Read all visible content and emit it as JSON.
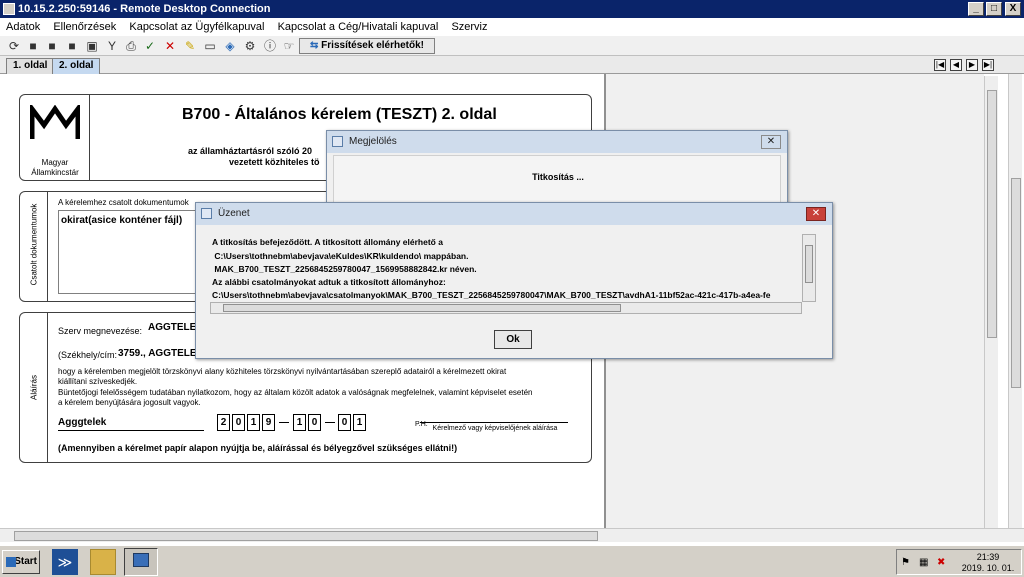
{
  "window": {
    "title": "10.15.2.250:59146 - Remote Desktop Connection",
    "min_label": "_",
    "max_label": "□",
    "close_label": "X"
  },
  "menu": {
    "items": [
      "Adatok",
      "Ellenőrzések",
      "Kapcsolat az Ügyfélkapuval",
      "Kapcsolat a Cég/Hivatali kapuval",
      "Szerviz"
    ]
  },
  "toolbar": {
    "update_label": "Frissítések elérhetők!"
  },
  "page_tabs": [
    "1. oldal",
    "2. oldal"
  ],
  "nav_buttons": [
    "|◀",
    "◀",
    "▶",
    "▶|"
  ],
  "form": {
    "logo_line1": "Magyar",
    "logo_line2": "Államkincstár",
    "title": "B700 - Általános kérelem (TESZT) 2. oldal",
    "subtitle1": "az államháztartásról szóló 20",
    "subtitle2": "vezetett közhiteles tö",
    "attach_side": "Csatolt dokumentumok",
    "attach_header": "A kérelemhez csatolt dokumentumok",
    "attach_value": "okirat(asice konténer fájl)",
    "sign_side": "Aláírás",
    "org_label": "Szerv megnevezése:",
    "org_value": "AGGTELE",
    "seat_label": "(Székhely/cím:",
    "seat_value": "3759., AGGTELE",
    "statement1": "hogy a kérelemben megjelölt törzskönyvi alany közhiteles törzskönyvi nyilvántartásában szereplő adatairól a kérelmezett okirat",
    "statement2": "kiállítani szíveskedjék.",
    "statement3": "Büntetőjogi felelősségem tudatában nyilatkozom, hogy az általam közölt adatok a valóságnak megfelelnek, valamint képviselet esetén",
    "statement4": "a kérelem benyújtására jogosult vagyok.",
    "place": "Agggtelek",
    "date_digits": [
      "2",
      "0",
      "1",
      "9",
      "1",
      "0",
      "0",
      "1"
    ],
    "ph": "P.H.",
    "sign_caption": "Kérelmező vagy képviselőjének aláírása",
    "footnote": "(Amennyiben a kérelmet papír alapon nyújtja be, aláírással és bélyegzővel szükséges ellátni!)"
  },
  "dialog_megjeloles": {
    "title": "Megjelölés",
    "message": "Titkosítás ..."
  },
  "dialog_uzenet": {
    "title": "Üzenet",
    "lines": [
      "A titkosítás befejeződött. A titkosított állomány elérhető a",
      " C:\\Users\\tothnebm\\abevjava\\eKuldes\\KR\\kuldendo\\ mappában.",
      " MAK_B700_TESZT_2256845259780047_1569958882842.kr néven.",
      "Az alábbi csatolmányokat adtuk a titkosított állományhoz:",
      "C:\\Users\\tothnebm\\abevjava\\csatolmanyok\\MAK_B700_TESZT_2256845259780047\\MAK_B700_TESZT\\avdhA1-11bf52ac-421c-417b-a4ea-fe"
    ],
    "ok_label": "Ok"
  },
  "taskbar": {
    "start_label": "Start",
    "time": "21:39",
    "date": "2019. 10. 01."
  },
  "colors": {
    "titlebar": "#0a246a",
    "dialog_title": "#cfdcec",
    "close_red": "#c8413a"
  }
}
